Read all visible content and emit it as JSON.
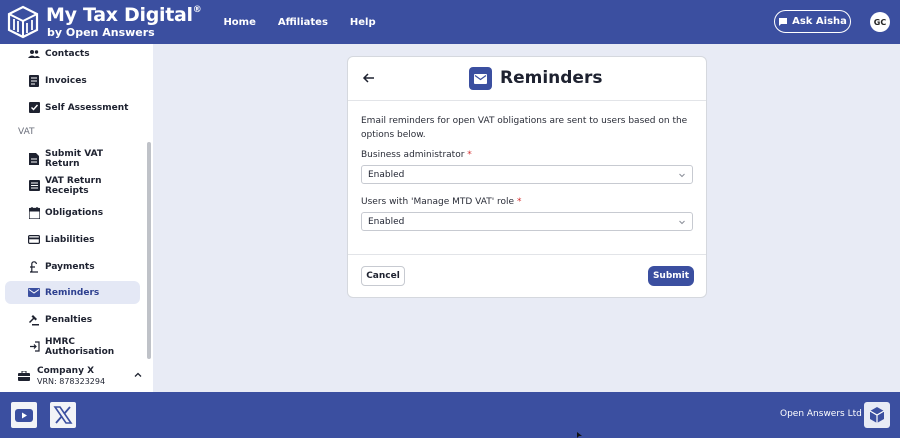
{
  "header": {
    "app_title": "My Tax Digital",
    "registered": "®",
    "app_subtitle": "by Open Answers",
    "nav": [
      {
        "label": "Home"
      },
      {
        "label": "Affiliates"
      },
      {
        "label": "Help"
      }
    ],
    "ask_button": "Ask Aisha",
    "avatar_initials": "GC"
  },
  "sidebar": {
    "items_top": [
      {
        "label": "Contacts",
        "icon": "contacts-icon"
      },
      {
        "label": "Invoices",
        "icon": "invoices-icon"
      },
      {
        "label": "Self Assessment",
        "icon": "checkbox-icon"
      }
    ],
    "section_label": "VAT",
    "items_vat": [
      {
        "label": "Submit VAT Return",
        "icon": "document-icon"
      },
      {
        "label": "VAT Return Receipts",
        "icon": "receipt-icon"
      },
      {
        "label": "Obligations",
        "icon": "calendar-icon"
      },
      {
        "label": "Liabilities",
        "icon": "credit-card-icon"
      },
      {
        "label": "Payments",
        "icon": "pound-icon"
      },
      {
        "label": "Reminders",
        "icon": "mail-icon",
        "active": true
      },
      {
        "label": "Penalties",
        "icon": "gavel-icon"
      },
      {
        "label": "HMRC Authorisation",
        "icon": "login-icon"
      }
    ],
    "company": {
      "name": "Company X",
      "vrn": "VRN: 878323294"
    }
  },
  "card": {
    "title": "Reminders",
    "description": "Email reminders for open VAT obligations are sent to users based on the options below.",
    "fields": [
      {
        "label": "Business administrator",
        "required_mark": "*",
        "value": "Enabled"
      },
      {
        "label": "Users with 'Manage MTD VAT' role",
        "required_mark": "*",
        "value": "Enabled"
      }
    ],
    "cancel_label": "Cancel",
    "submit_label": "Submit"
  },
  "footer": {
    "company_text": "Open Answers Ltd"
  },
  "colors": {
    "brand": "#3b4fa0",
    "background": "#e8ebf5",
    "active_item_bg": "#e4e8f5",
    "required": "#d32f2f"
  }
}
